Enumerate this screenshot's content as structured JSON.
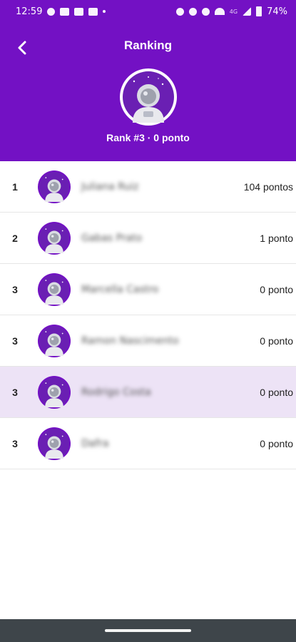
{
  "status_bar": {
    "time": "12:59",
    "network_label": "4G",
    "battery": "74%"
  },
  "header": {
    "title": "Ranking",
    "rank_text": "Rank #3 · 0 ponto"
  },
  "ranking": [
    {
      "position": "1",
      "name": "Juliana Ruiz",
      "points": "104 pontos"
    },
    {
      "position": "2",
      "name": "Gabas Prato",
      "points": "1 ponto"
    },
    {
      "position": "3",
      "name": "Marcella Castro",
      "points": "0 ponto"
    },
    {
      "position": "3",
      "name": "Ramon Nascimento",
      "points": "0 ponto"
    },
    {
      "position": "3",
      "name": "Rodrigo Costa",
      "points": "0 ponto",
      "highlighted": true
    },
    {
      "position": "3",
      "name": "Dafra",
      "points": "0 ponto"
    }
  ],
  "colors": {
    "primary": "#7311c4",
    "highlight_row": "#ede3f6",
    "nav_bar": "#3e454a"
  },
  "icons": {
    "back": "chevron-left-icon",
    "avatar": "astronaut-icon"
  }
}
